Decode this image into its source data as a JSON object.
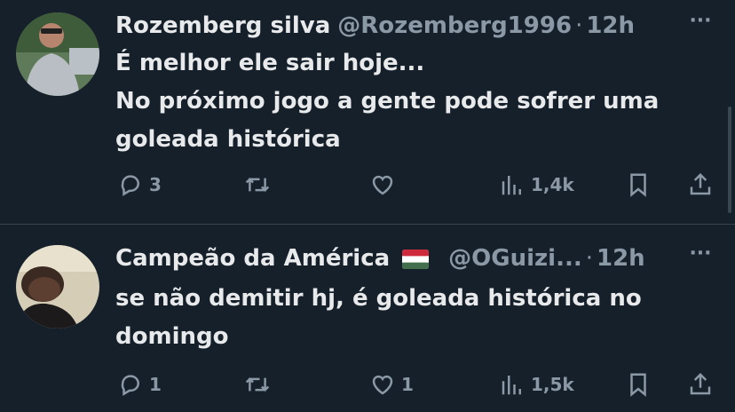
{
  "tweets": [
    {
      "author_name": "Rozemberg silva",
      "handle": "@Rozemberg1996",
      "separator": "·",
      "time": "12h",
      "flag": "",
      "text_lines": [
        "É melhor ele sair hoje...",
        "No próximo jogo a gente pode sofrer uma",
        "goleada histórica"
      ],
      "replies": "3",
      "retweets": "",
      "likes": "",
      "views": "1,4k"
    },
    {
      "author_name": "Campeão da América",
      "handle": "@OGuizi...",
      "separator": "·",
      "time": "12h",
      "flag": "hungary-style-flag",
      "text_lines": [
        "se não demitir hj, é goleada histórica no",
        "domingo"
      ],
      "replies": "1",
      "retweets": "",
      "likes": "1",
      "views": "1,5k"
    }
  ],
  "more_label": "···",
  "colors": {
    "background": "#15202b",
    "text": "#e7e9ea",
    "secondary": "#8b98a5",
    "divider": "#38444d"
  },
  "icons": [
    "reply-icon",
    "retweet-icon",
    "like-icon",
    "views-icon",
    "bookmark-icon",
    "share-icon",
    "more-icon"
  ]
}
